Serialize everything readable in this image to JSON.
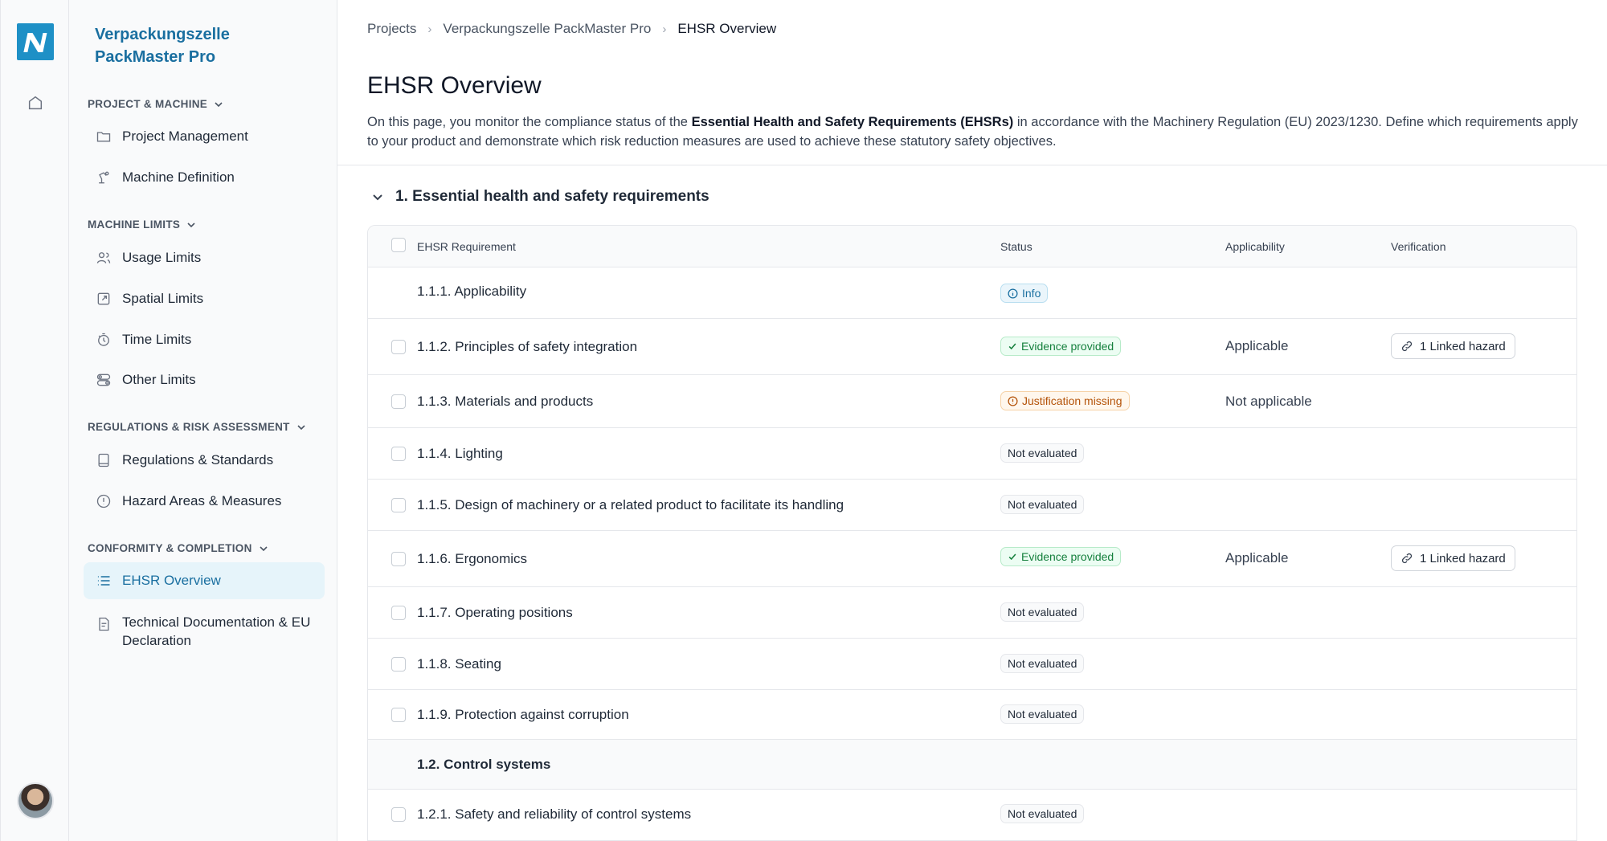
{
  "app": {
    "project_title": "Verpackungszelle PackMaster Pro"
  },
  "rail": {
    "logo_icon": "nexus-logo-icon",
    "home_icon": "home-icon",
    "avatar": "user-avatar"
  },
  "sidebar": {
    "sections": [
      {
        "title": "PROJECT & MACHINE",
        "items": [
          {
            "label": "Project Management",
            "icon": "folder-icon"
          },
          {
            "label": "Machine Definition",
            "icon": "robot-arm-icon"
          }
        ]
      },
      {
        "title": "MACHINE LIMITS",
        "items": [
          {
            "label": "Usage Limits",
            "icon": "users-icon"
          },
          {
            "label": "Spatial Limits",
            "icon": "expand-icon"
          },
          {
            "label": "Time Limits",
            "icon": "stopwatch-icon"
          },
          {
            "label": "Other Limits",
            "icon": "toggles-icon"
          }
        ]
      },
      {
        "title": "REGULATIONS & RISK ASSESSMENT",
        "items": [
          {
            "label": "Regulations & Standards",
            "icon": "book-icon"
          },
          {
            "label": "Hazard Areas & Measures",
            "icon": "alert-circle-icon"
          }
        ]
      },
      {
        "title": "CONFORMITY & COMPLETION",
        "items": [
          {
            "label": "EHSR Overview",
            "icon": "list-icon",
            "active": true
          },
          {
            "label": "Technical Documentation & EU Declaration",
            "icon": "document-icon"
          }
        ]
      }
    ]
  },
  "breadcrumb": [
    "Projects",
    "Verpackungszelle PackMaster Pro",
    "EHSR Overview"
  ],
  "page": {
    "title": "EHSR Overview",
    "intro_prefix": "On this page, you monitor the compliance status of the ",
    "intro_bold": "Essential Health and Safety Requirements (EHSRs)",
    "intro_suffix": " in accordance with the Machinery Regulation (EU) 2023/1230. Define which requirements apply to your product and demonstrate which risk reduction measures are used to achieve these statutory safety objectives."
  },
  "group": {
    "title": "1. Essential health and safety requirements"
  },
  "table": {
    "headers": {
      "requirement": "EHSR Requirement",
      "status": "Status",
      "applicability": "Applicability",
      "verification": "Verification"
    },
    "rows": [
      {
        "req": "1.1.1. Applicability",
        "status": "Info",
        "status_type": "info",
        "checkbox": false,
        "applicability": "",
        "verification": ""
      },
      {
        "req": "1.1.2. Principles of safety integration",
        "status": "Evidence provided",
        "status_type": "ok",
        "checkbox": true,
        "applicability": "Applicable",
        "verification": "1 Linked hazard"
      },
      {
        "req": "1.1.3. Materials and products",
        "status": "Justification missing",
        "status_type": "warn",
        "checkbox": true,
        "applicability": "Not applicable",
        "verification": ""
      },
      {
        "req": "1.1.4. Lighting",
        "status": "Not evaluated",
        "status_type": "neutral",
        "checkbox": true,
        "applicability": "",
        "verification": ""
      },
      {
        "req": "1.1.5. Design of machinery or a related product to facilitate its handling",
        "status": "Not evaluated",
        "status_type": "neutral",
        "checkbox": true,
        "applicability": "",
        "verification": ""
      },
      {
        "req": "1.1.6. Ergonomics",
        "status": "Evidence provided",
        "status_type": "ok",
        "checkbox": true,
        "applicability": "Applicable",
        "verification": "1 Linked hazard"
      },
      {
        "req": "1.1.7. Operating positions",
        "status": "Not evaluated",
        "status_type": "neutral",
        "checkbox": true,
        "applicability": "",
        "verification": ""
      },
      {
        "req": "1.1.8. Seating",
        "status": "Not evaluated",
        "status_type": "neutral",
        "checkbox": true,
        "applicability": "",
        "verification": ""
      },
      {
        "req": "1.1.9. Protection against corruption",
        "status": "Not evaluated",
        "status_type": "neutral",
        "checkbox": true,
        "applicability": "",
        "verification": ""
      },
      {
        "req": "1.2. Control systems",
        "subheader": true
      },
      {
        "req": "1.2.1. Safety and reliability of control systems",
        "status": "Not evaluated",
        "status_type": "neutral",
        "checkbox": true,
        "applicability": "",
        "verification": ""
      }
    ]
  },
  "colors": {
    "accent": "#1a6fa0",
    "logo": "#1e90c6",
    "ok": "#15803d",
    "warn": "#b45309"
  }
}
